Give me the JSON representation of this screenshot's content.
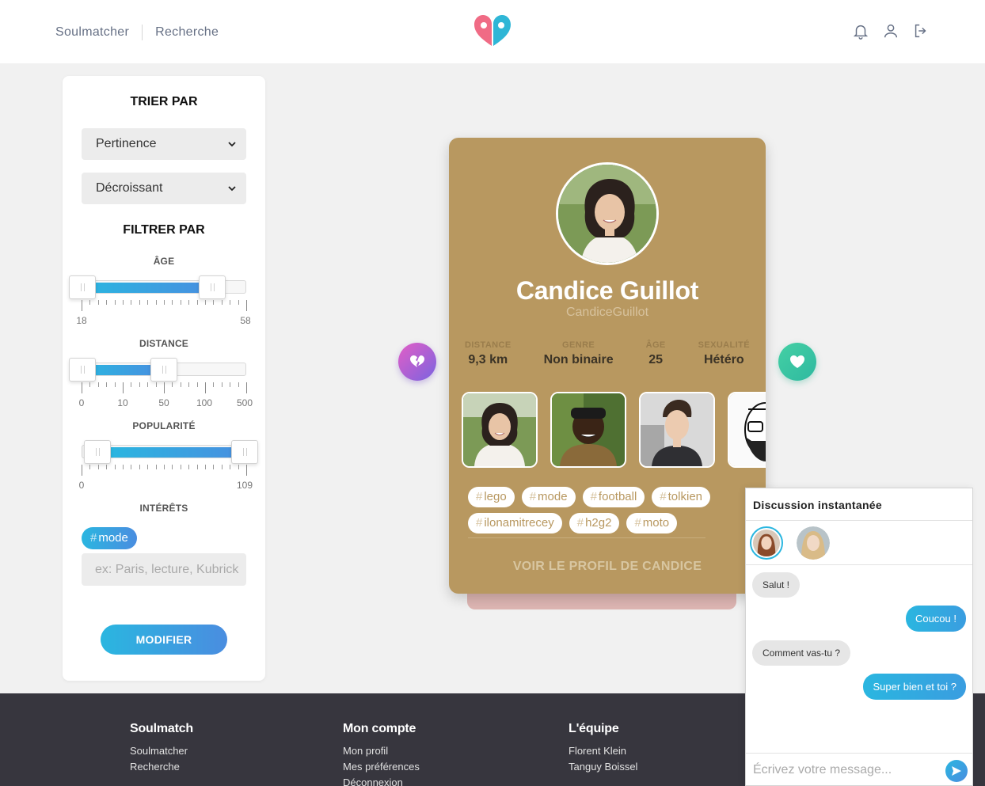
{
  "header": {
    "nav": [
      "Soulmatcher",
      "Recherche"
    ],
    "icons": [
      "bell-icon",
      "user-icon",
      "logout-icon"
    ]
  },
  "filters": {
    "sort_title": "TRIER PAR",
    "sort_by": "Pertinence",
    "sort_order": "Décroissant",
    "filter_title": "FILTRER PAR",
    "age": {
      "label": "ÂGE",
      "min": 18,
      "max": 58,
      "selected": [
        18,
        52
      ],
      "ticks": [
        "18",
        "58"
      ]
    },
    "distance": {
      "label": "DISTANCE",
      "ticks": [
        "0",
        "10",
        "50",
        "100",
        "500"
      ],
      "selected": [
        0,
        50
      ]
    },
    "popularity": {
      "label": "POPULARITÉ",
      "min": 0,
      "max": 109,
      "selected": [
        4,
        109
      ],
      "ticks": [
        "0",
        "109"
      ]
    },
    "interests": {
      "label": "INTÉRÊTS",
      "hash": "#",
      "selected_tag": "mode",
      "placeholder": "ex: Paris, lecture, Kubrick"
    },
    "submit": "MODIFIER"
  },
  "profile": {
    "name": "Candice Guillot",
    "username": "CandiceGuillot",
    "stats": [
      {
        "key": "DISTANCE",
        "value": "9,3 km"
      },
      {
        "key": "GENRE",
        "value": "Non binaire"
      },
      {
        "key": "ÂGE",
        "value": "25"
      },
      {
        "key": "SEXUALITÉ",
        "value": "Hétéro"
      }
    ],
    "tags": [
      "lego",
      "mode",
      "football",
      "tolkien",
      "ilonamitrecey",
      "h2g2",
      "moto"
    ],
    "view_profile": "VOIR LE PROFIL DE CANDICE",
    "card_color": "#b89860"
  },
  "footer": {
    "cols": [
      {
        "title": "Soulmatch",
        "links": [
          "Soulmatcher",
          "Recherche"
        ]
      },
      {
        "title": "Mon compte",
        "links": [
          "Mon profil",
          "Mes préférences",
          "Déconnexion"
        ]
      },
      {
        "title": "L'équipe",
        "links": [
          "Florent Klein",
          "Tanguy Boissel"
        ]
      }
    ]
  },
  "chat": {
    "title": "Discussion instantanée",
    "messages": [
      {
        "from": "them",
        "text": "Salut !"
      },
      {
        "from": "me",
        "text": "Coucou !"
      },
      {
        "from": "them",
        "text": "Comment vas-tu ?"
      },
      {
        "from": "me",
        "text": "Super bien et toi ?"
      }
    ],
    "placeholder": "Écrivez votre message..."
  },
  "colors": {
    "accent": "#2ab6e0",
    "accent2": "#4a8de0",
    "footer": "#37363e"
  }
}
